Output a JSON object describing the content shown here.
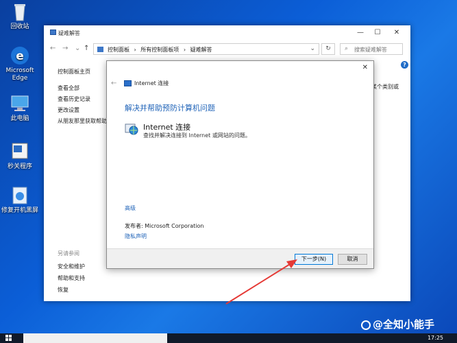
{
  "desktop": {
    "icons": [
      {
        "label": "回收站",
        "icon": "recycle-bin-icon"
      },
      {
        "label": "Microsoft\nEdge",
        "icon": "edge-icon"
      },
      {
        "label": "此电脑",
        "icon": "computer-icon"
      },
      {
        "label": "秒关程序",
        "icon": "app-icon"
      },
      {
        "label": "修复开机黑屏",
        "icon": "repair-icon"
      }
    ]
  },
  "window": {
    "title": "疑难解答",
    "controls": {
      "minimize": "—",
      "maximize": "☐",
      "close": "✕"
    },
    "nav": {
      "back": "←",
      "forward": "→",
      "down": "⌄",
      "up": "↑"
    },
    "breadcrumbs": [
      "控制面板",
      "›",
      "所有控制面板项",
      "›",
      "疑难解答"
    ],
    "refresh": "↻",
    "search_placeholder": "搜索疑难解答",
    "left_nav": {
      "home": "控制面板主页",
      "links": [
        "查看全部",
        "查看历史记录",
        "更改设置",
        "从朋友那里获取帮助"
      ]
    },
    "see_also": {
      "heading": "另请参阅",
      "links": [
        "安全和维护",
        "帮助和支持",
        "恢复"
      ]
    },
    "right_partial_text": "某个类别或",
    "help": "?"
  },
  "dialog": {
    "header": "Internet 连接",
    "close": "✕",
    "back": "←",
    "heading": "解决并帮助预防计算机问题",
    "item_title": "Internet 连接",
    "item_desc": "查找并解决连接到 Internet 或网站的问题。",
    "advanced": "高级",
    "publisher": "发布者:  Microsoft Corporation",
    "privacy": "隐私声明",
    "next_button": "下一步(N)",
    "cancel_button": "取消"
  },
  "taskbar": {
    "time": "17:25"
  },
  "watermark": "@全知小能手",
  "colors": {
    "accent": "#1f63b8",
    "highlight_border": "#0078d7",
    "arrow": "#e53935"
  }
}
